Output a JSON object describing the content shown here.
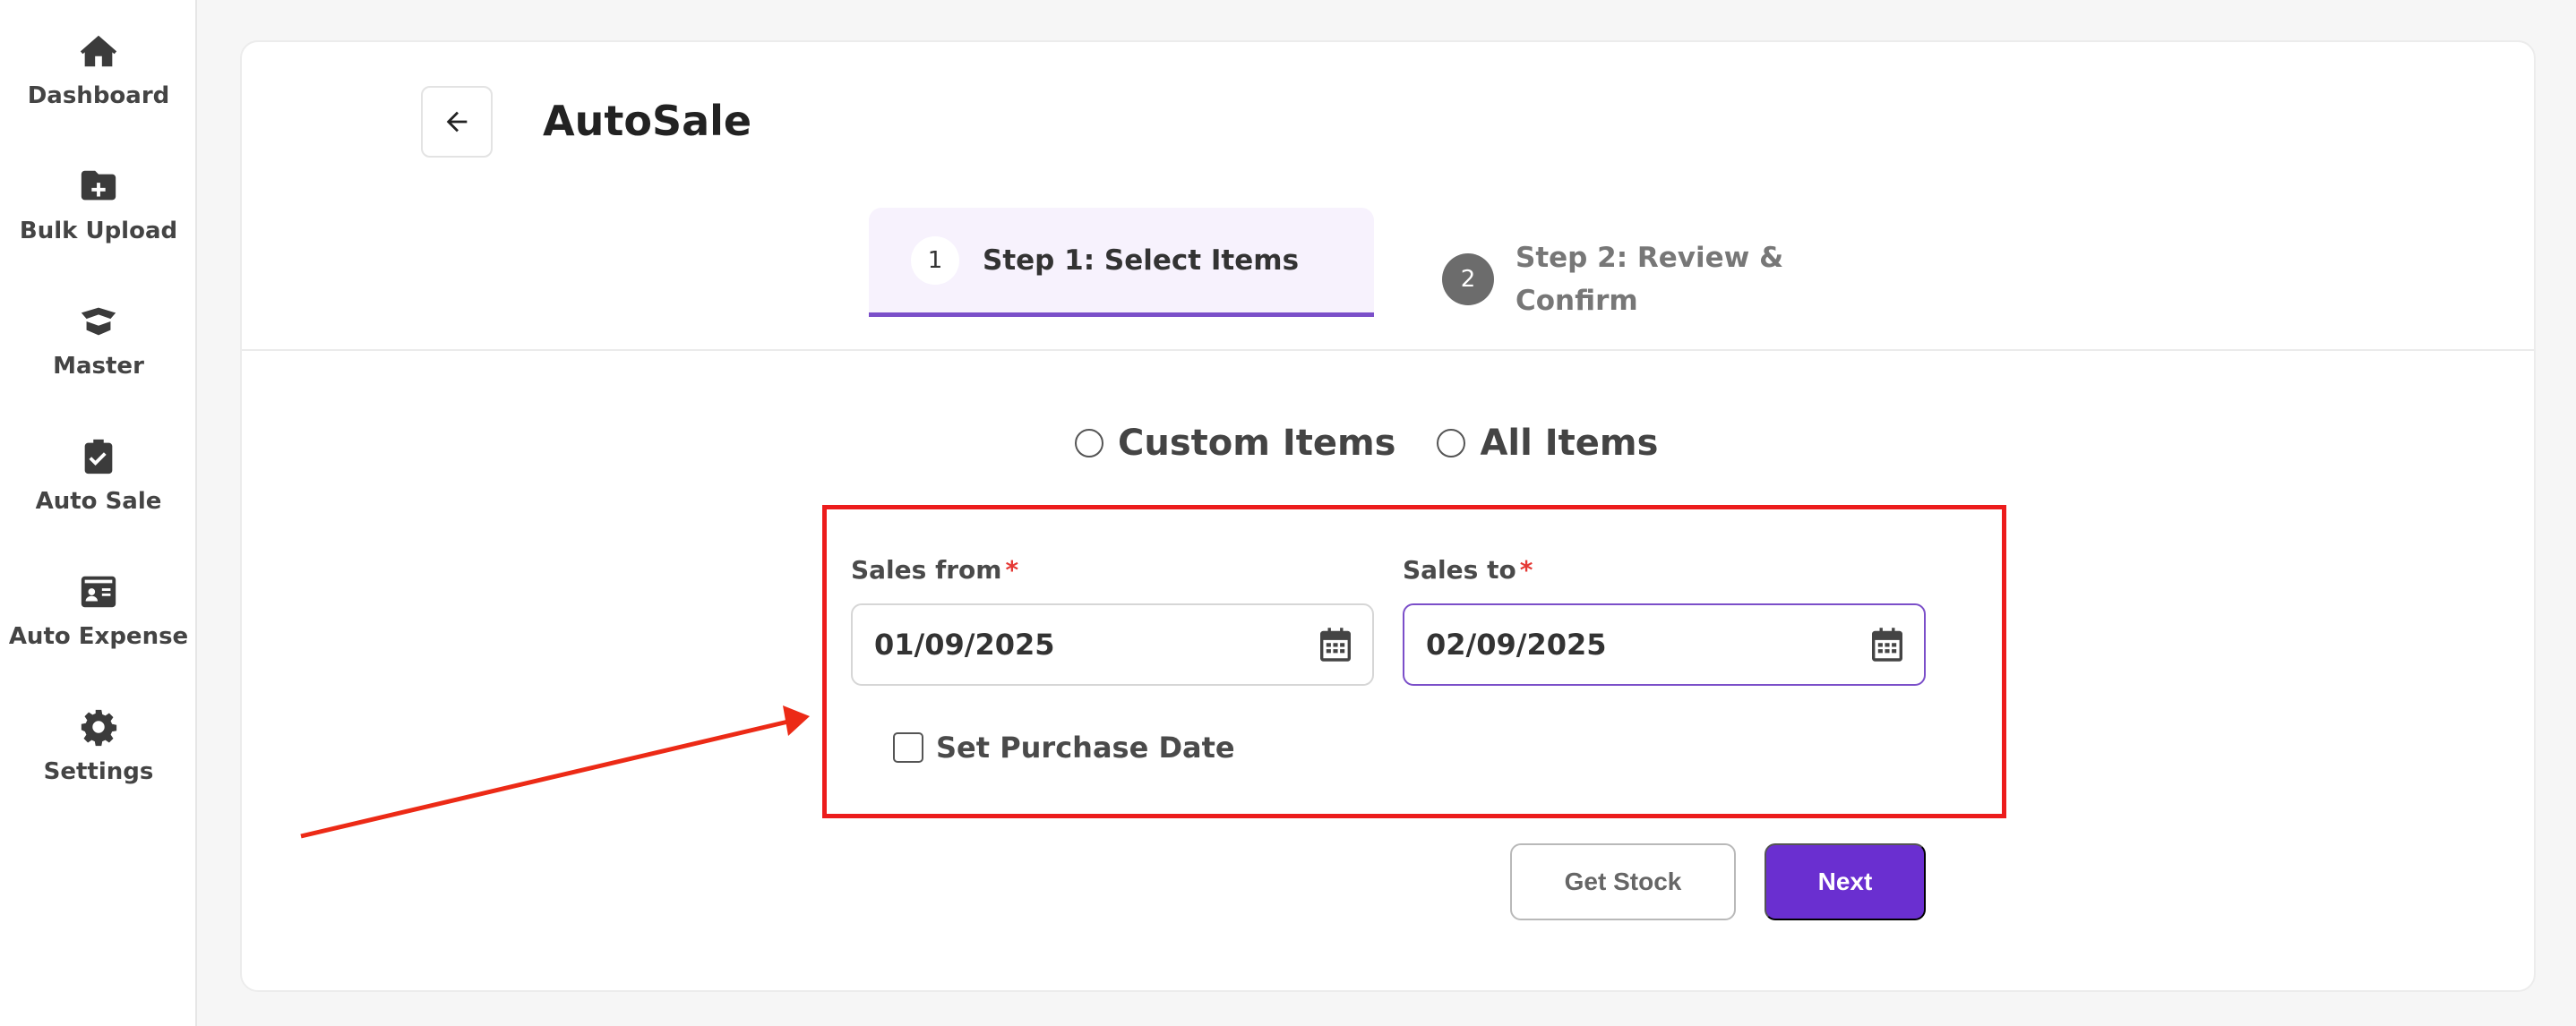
{
  "sidebar": {
    "items": [
      {
        "label": "Dashboard",
        "icon": "home-icon"
      },
      {
        "label": "Bulk Upload",
        "icon": "folder-plus-icon"
      },
      {
        "label": "Master",
        "icon": "box-icon"
      },
      {
        "label": "Auto Sale",
        "icon": "clipboard-check-icon"
      },
      {
        "label": "Auto Expense",
        "icon": "id-card-icon"
      },
      {
        "label": "Settings",
        "icon": "gear-icon"
      }
    ]
  },
  "header": {
    "back_icon": "arrow-left-icon",
    "title": "AutoSale"
  },
  "stepper": {
    "steps": [
      {
        "number": "1",
        "label": "Step 1: Select Items",
        "active": true
      },
      {
        "number": "2",
        "label": "Step 2: Review & Confirm",
        "active": false
      }
    ]
  },
  "item_mode": {
    "options": [
      {
        "label": "Custom Items",
        "selected": false
      },
      {
        "label": "All Items",
        "selected": false
      }
    ]
  },
  "form": {
    "sales_from": {
      "label": "Sales from",
      "required_mark": "*",
      "value": "01/09/2025",
      "icon": "calendar-icon"
    },
    "sales_to": {
      "label": "Sales to",
      "required_mark": "*",
      "value": "02/09/2025",
      "icon": "calendar-icon"
    },
    "set_purchase_date": {
      "label": "Set Purchase Date",
      "checked": false
    }
  },
  "actions": {
    "get_stock_label": "Get Stock",
    "next_label": "Next"
  },
  "colors": {
    "accent": "#6a2fd0",
    "highlight_box": "#ec1c1c",
    "annotation_arrow": "#ec2a16",
    "required": "#e53935"
  }
}
